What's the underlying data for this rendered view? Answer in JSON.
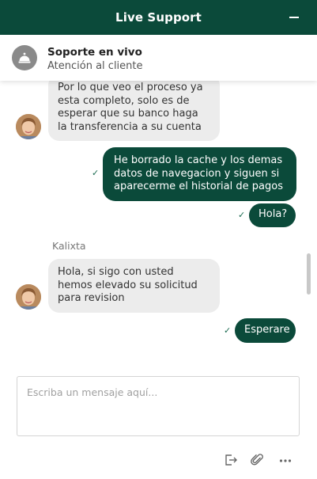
{
  "header": {
    "title": "Live Support"
  },
  "agent": {
    "name": "Soporte en vivo",
    "subtitle": "Atención al cliente"
  },
  "messages": [
    {
      "direction": "in",
      "text": "Por lo que veo el proceso ya esta completo, solo es de esperar que su banco haga la transferencia a su cuenta"
    },
    {
      "direction": "out",
      "text": "He borrado la cache y los demas datos de navegacion y siguen si aparecerme el historial de pagos",
      "status": "✓"
    },
    {
      "direction": "out",
      "text": "Hola?",
      "status": "✓"
    },
    {
      "direction": "in",
      "sender": "Kalixta",
      "text": "Hola, si sigo con usted hemos elevado su solicitud para revision"
    },
    {
      "direction": "out",
      "text": "Esperare",
      "status": "✓"
    }
  ],
  "composer": {
    "placeholder": "Escriba un mensaje aquí..."
  },
  "toolbar": {
    "icons": [
      "exit-icon",
      "paperclip-icon",
      "more-icon"
    ]
  },
  "colors": {
    "brand": "#0b4a3a",
    "incoming_bubble": "#ececec"
  }
}
